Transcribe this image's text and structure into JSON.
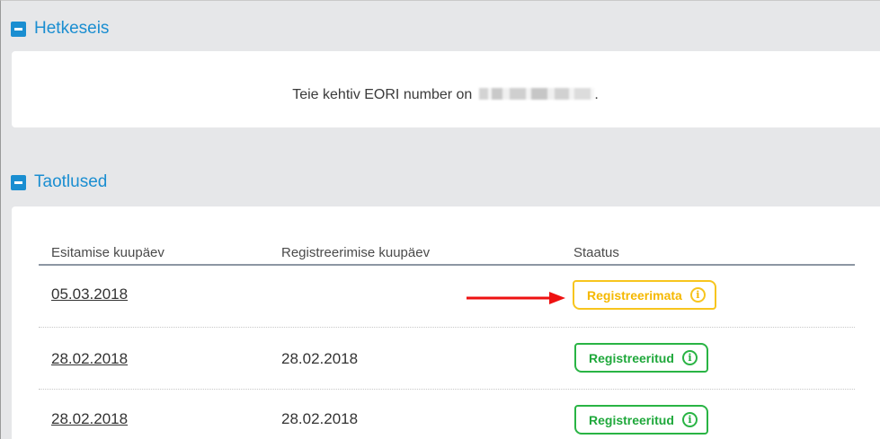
{
  "sections": {
    "summary": {
      "title": "Hetkeseis",
      "eori_text": "Teie kehtiv EORI number on",
      "eori_suffix": "."
    },
    "applications": {
      "title": "Taotlused"
    }
  },
  "table": {
    "headers": [
      "Esitamise kuupäev",
      "Registreerimise kuupäev",
      "Staatus"
    ],
    "rows": [
      {
        "submitted": "05.03.2018",
        "registered": "",
        "status": "Registreerimata",
        "status_color": "#f5b800"
      },
      {
        "submitted": "28.02.2018",
        "registered": "28.02.2018",
        "status": "Registreeritud",
        "status_color": "#1fa83b"
      },
      {
        "submitted": "28.02.2018",
        "registered": "28.02.2018",
        "status": "Registreeritud",
        "status_color": "#1fa83b"
      }
    ]
  },
  "icons": {
    "collapse": "minus-icon",
    "info": "info-icon",
    "annotation": "red-arrow"
  },
  "info_glyph": "i"
}
